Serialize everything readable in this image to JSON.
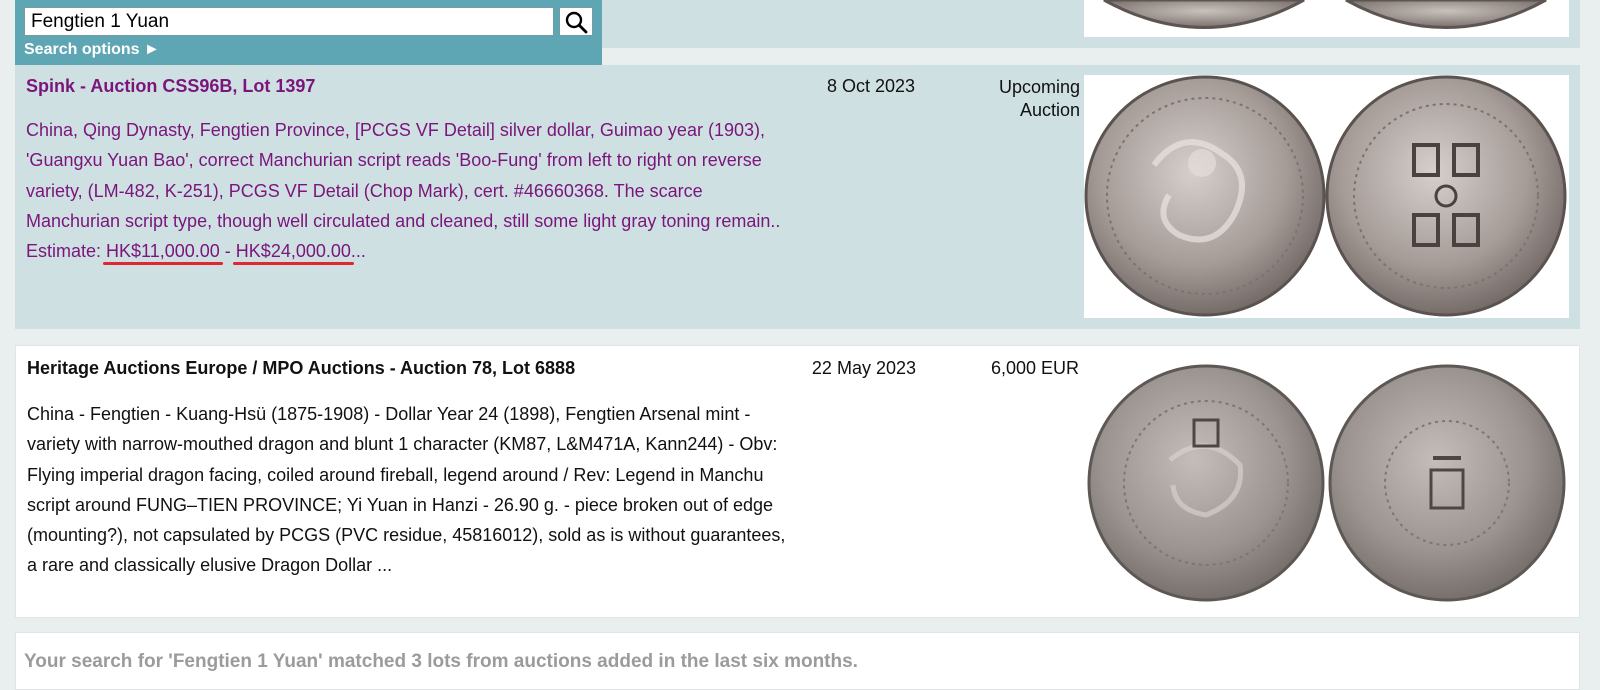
{
  "search": {
    "query": "Fengtien 1 Yuan",
    "options_label": "Search options ►"
  },
  "lots": [
    {
      "title": "Spink - Auction CSS96B, Lot 1397",
      "desc_main": "China, Qing Dynasty, Fengtien Province, [PCGS VF Detail] silver dollar, Guimao year (1903), 'Guangxu Yuan Bao', correct Manchurian script reads 'Boo-Fung' from left to right on reverse variety, (LM-482, K-251), PCGS VF Detail (Chop Mark), cert. #46660368. The scarce Manchurian script type, though well circulated and cleaned, still some light gray toning remain.. Estimate: ",
      "estimate_low": "HK$11,000.00",
      "sep": " - ",
      "estimate_high": "HK$24,000.00",
      "ellipsis": "...",
      "date": "8 Oct 2023",
      "price_line1": "Upcoming",
      "price_line2": "Auction"
    },
    {
      "title": "Heritage Auctions Europe / MPO Auctions - Auction 78, Lot 6888",
      "desc": "China - Fengtien - Kuang-Hsü (1875-1908) - Dollar Year 24 (1898), Fengtien Arsenal mint - variety with narrow-mouthed dragon and blunt 1 character (KM87, L&M471A, Kann244) - Obv: Flying imperial dragon facing, coiled around fireball, legend around / Rev: Legend in Manchu script around FUNG–TIEN PROVINCE; Yi Yuan in Hanzi - 26.90 g. - piece broken out of edge (mounting?), not capsulated by PCGS (PVC residue, 45816012), sold as is without guarantees, a rare and classically elusive Dragon Dollar ...",
      "date": "22 May 2023",
      "price": "6,000 EUR"
    }
  ],
  "footer": {
    "summary": "Your search for 'Fengtien 1 Yuan' matched 3 lots from auctions added in the last six months."
  },
  "colors": {
    "lot_title_purple": "#7b157b",
    "highlight_underline": "#e0262e",
    "search_panel": "#5fa6b4",
    "row_bg": "#cfe0e3"
  }
}
